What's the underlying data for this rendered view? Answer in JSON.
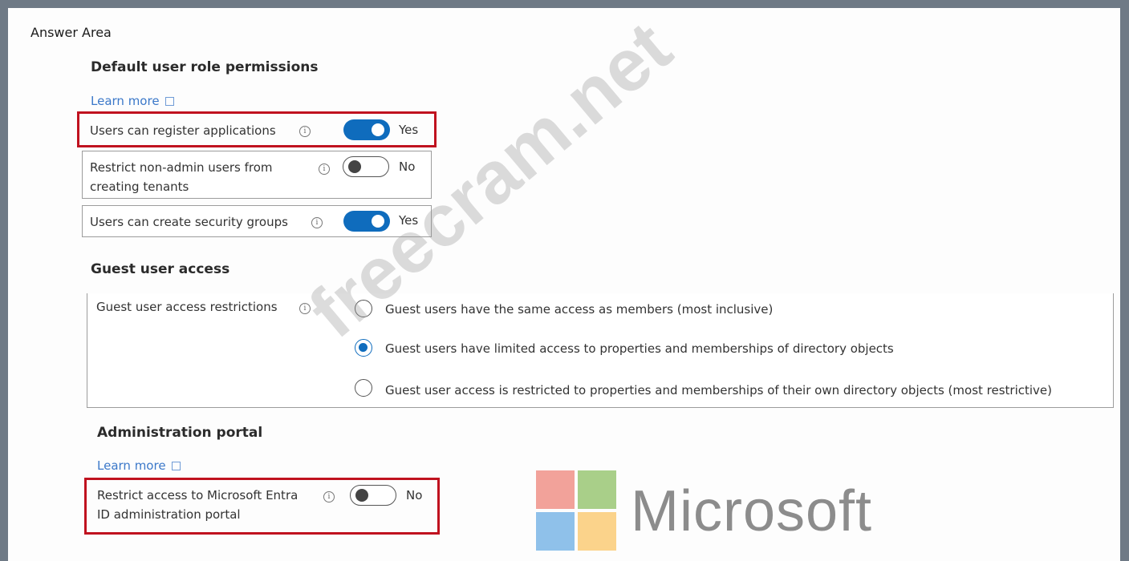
{
  "answer_area": "Answer Area",
  "default_permissions": {
    "heading": "Default user role permissions",
    "learn_more": "Learn more",
    "register_apps": {
      "label": "Users can register applications",
      "value": "Yes",
      "enabled": true
    },
    "restrict_tenants": {
      "label_line1": "Restrict non-admin users from",
      "label_line2": "creating tenants",
      "value": "No",
      "enabled": false
    },
    "security_groups": {
      "label": "Users can create security groups",
      "value": "Yes",
      "enabled": true
    }
  },
  "guest_access": {
    "heading": "Guest user access",
    "restrictions_label": "Guest user access restrictions",
    "options": [
      {
        "label": "Guest users have the same access as members (most inclusive)",
        "selected": false
      },
      {
        "label": "Guest users have limited access to properties and memberships of directory objects",
        "selected": true
      },
      {
        "label": "Guest user access is restricted to properties and memberships of their own directory objects (most restrictive)",
        "selected": false
      }
    ]
  },
  "admin_portal": {
    "heading": "Administration portal",
    "learn_more": "Learn more",
    "restrict_access": {
      "label_line1": "Restrict access to Microsoft Entra",
      "label_line2": "ID administration portal",
      "value": "No",
      "enabled": false
    }
  },
  "watermark": "freecram.net",
  "logo": {
    "word": "Microsoft",
    "colors": [
      "#f2a29a",
      "#a9cf89",
      "#8fc1ea",
      "#fbd38b"
    ]
  }
}
